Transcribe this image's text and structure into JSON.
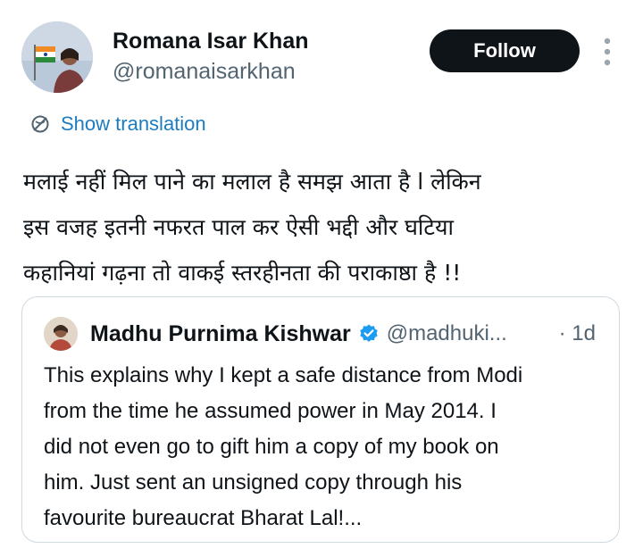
{
  "author": {
    "name": "Romana Isar Khan",
    "handle": "@romanaisarkhan"
  },
  "actions": {
    "follow_label": "Follow",
    "more_icon": "more-vertical-icon"
  },
  "translation": {
    "label": "Show translation",
    "icon": "translate-globe-icon"
  },
  "tweet": {
    "lines": [
      "मलाई नहीं मिल पाने का मलाल है समझ आता है l लेकिन",
      "इस वजह इतनी नफरत पाल कर ऐसी भद्दी और घटिया",
      "कहानियां  गढ़ना तो वाकई स्तरहीनता की पराकाष्ठा है !!"
    ]
  },
  "quoted": {
    "name": "Madhu Purnima Kishwar",
    "handle": "@madhuki...",
    "time": "· 1d",
    "verified_icon": "verified-badge-icon",
    "lines": [
      "This explains why I kept a safe distance from Modi",
      "from the time he assumed power in May 2014. I",
      "did not even go to gift him a copy of my book on",
      "him. Just sent an unsigned copy through his",
      "favourite bureaucrat Bharat Lal!..."
    ]
  },
  "colors": {
    "text": "#0f1419",
    "secondary": "#536471",
    "link": "#1d7bbf",
    "button_bg": "#0f1419",
    "button_text": "#ffffff",
    "card_border": "#cfd9de",
    "verified": "#1d9bf0"
  }
}
